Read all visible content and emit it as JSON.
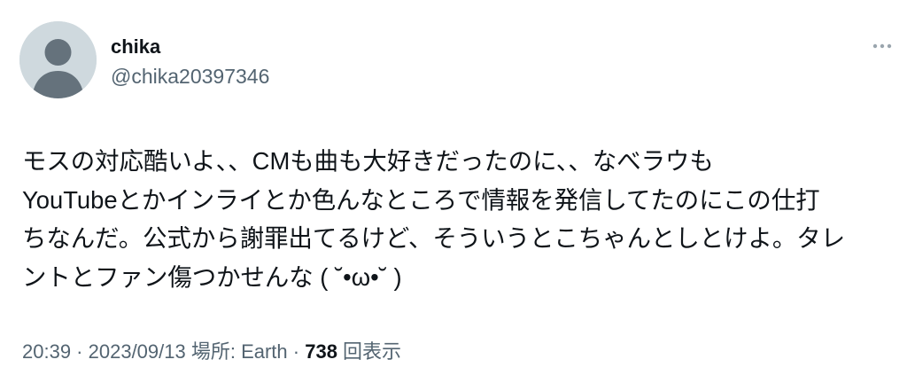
{
  "user": {
    "display_name": "chika",
    "handle": "@chika20397346",
    "avatar_icon": "default-avatar-icon"
  },
  "more_icon": "ellipsis-icon",
  "tweet": {
    "lines": [
      "モスの対応酷いよ、、CMも曲も大好きだったのに、、なべラウも",
      "YouTubeとかインライとか色んなところで情報を発信してたのにこの仕打",
      "ちなんだ。公式から謝罪出てるけど、そういうとこちゃんとしとけよ。タレ",
      "ントとファン傷つかせんな ( ˘•ω•˘ )"
    ]
  },
  "meta": {
    "time": "20:39",
    "sep1": " · ",
    "date": "2023/09/13",
    "location": " 場所: Earth",
    "sep2": " · ",
    "views_count": "738",
    "views_label": " 回表示"
  },
  "colors": {
    "text_primary": "#0f1419",
    "text_secondary": "#536471",
    "avatar_bg": "#cfd9de",
    "avatar_fg": "#65727c"
  }
}
